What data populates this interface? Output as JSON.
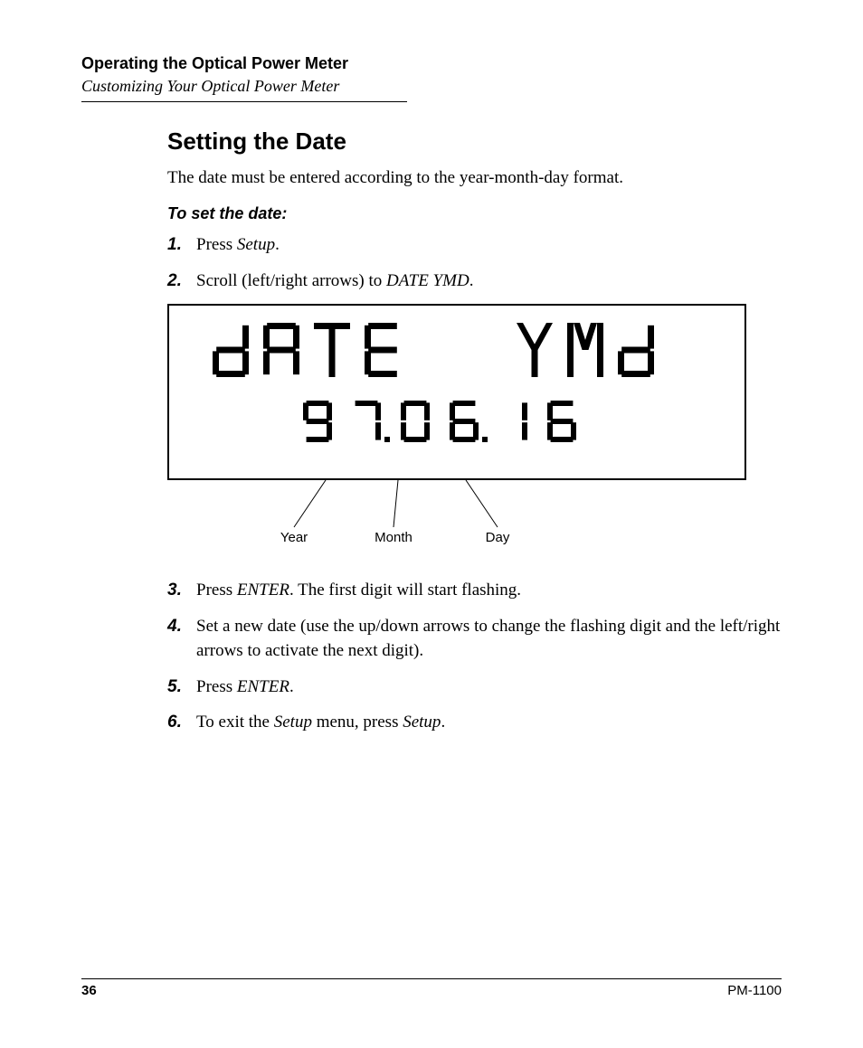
{
  "header": {
    "chapter": "Operating the Optical Power Meter",
    "section": "Customizing Your Optical Power Meter"
  },
  "title": "Setting the Date",
  "intro": "The date must be entered according to the year-month-day format.",
  "procedure_heading": "To set the date:",
  "steps": [
    {
      "n": "1.",
      "html": "Press <em>Setup</em>."
    },
    {
      "n": "2.",
      "html": "Scroll (left/right arrows) to <em>DATE YMD</em>."
    },
    {
      "n": "3.",
      "html": "Press <em>ENTER</em>. The first digit will start flashing."
    },
    {
      "n": "4.",
      "html": "Set a new date (use the up/down arrows to change the flashing digit and the left/right arrows to activate the next digit)."
    },
    {
      "n": "5.",
      "html": "Press <em>ENTER</em>."
    },
    {
      "n": "6.",
      "html": "To exit the <em>Setup</em> menu, press <em>Setup</em>."
    }
  ],
  "lcd": {
    "line1": "DATE YMD",
    "line2_year": "97",
    "line2_month": "06",
    "line2_day": "16",
    "callouts": {
      "year": "Year",
      "month": "Month",
      "day": "Day"
    }
  },
  "footer": {
    "page": "36",
    "model": "PM-1100"
  }
}
